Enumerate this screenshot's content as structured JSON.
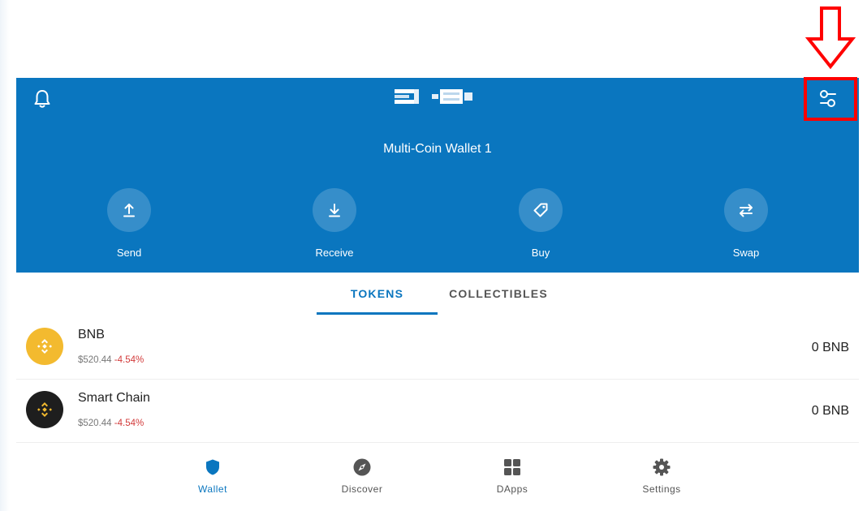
{
  "colors": {
    "accent": "#0a76bf",
    "negative": "#d23b3b",
    "annotation": "#ff0000"
  },
  "header": {
    "wallet_name": "Multi-Coin Wallet 1",
    "left_icon": "bell-icon",
    "right_icon": "sliders-icon"
  },
  "actions": [
    {
      "label": "Send",
      "icon": "upload-arrow-icon"
    },
    {
      "label": "Receive",
      "icon": "download-arrow-icon"
    },
    {
      "label": "Buy",
      "icon": "tag-icon"
    },
    {
      "label": "Swap",
      "icon": "swap-arrows-icon"
    }
  ],
  "tabs": [
    {
      "label": "TOKENS",
      "active": true
    },
    {
      "label": "COLLECTIBLES",
      "active": false
    }
  ],
  "tokens": [
    {
      "name": "BNB",
      "price": "$520.44",
      "change": "-4.54%",
      "balance": "0 BNB",
      "icon": "bnb-icon",
      "icon_color": "#f3ba2f"
    },
    {
      "name": "Smart Chain",
      "price": "$520.44",
      "change": "-4.54%",
      "balance": "0 BNB",
      "icon": "smart-chain-icon",
      "icon_color": "#1e1e1e"
    }
  ],
  "bottom_nav": [
    {
      "label": "Wallet",
      "icon": "shield-icon",
      "active": true
    },
    {
      "label": "Discover",
      "icon": "compass-icon",
      "active": false
    },
    {
      "label": "DApps",
      "icon": "grid-icon",
      "active": false
    },
    {
      "label": "Settings",
      "icon": "gear-icon",
      "active": false
    }
  ]
}
